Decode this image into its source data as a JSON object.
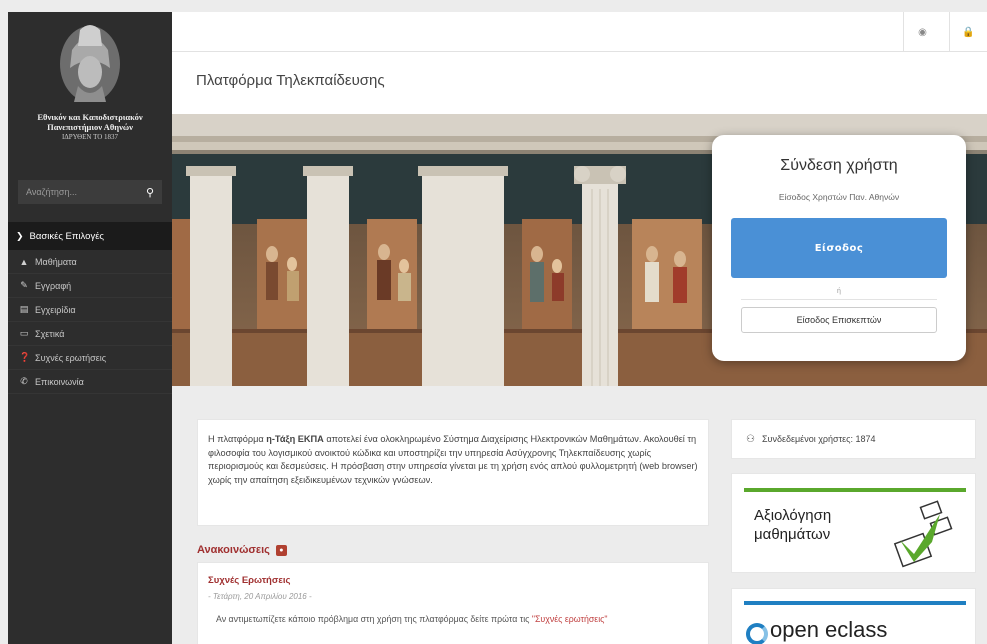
{
  "sidebar": {
    "university_name_line1": "Εθνικόν και Καποδιστριακόν",
    "university_name_line2": "Πανεπιστήμιον Αθηνών",
    "founded": "ΙΔΡΥΘΕΝ ΤΟ 1837",
    "search_placeholder": "Αναζήτηση...",
    "menu_header": "Βασικές Επιλογές",
    "items": [
      {
        "label": "Μαθήματα",
        "icon": "graduation-cap-icon"
      },
      {
        "label": "Εγγραφή",
        "icon": "edit-icon"
      },
      {
        "label": "Εγχειρίδια",
        "icon": "file-icon"
      },
      {
        "label": "Σχετικά",
        "icon": "credit-card-icon"
      },
      {
        "label": "Συχνές ερωτήσεις",
        "icon": "question-circle-icon"
      },
      {
        "label": "Επικοινωνία",
        "icon": "phone-icon"
      }
    ]
  },
  "topbar": {
    "icons": [
      "globe-icon",
      "lock-icon"
    ]
  },
  "page": {
    "title": "Πλατφόρμα Τηλεκπαίδευσης"
  },
  "login": {
    "title": "Σύνδεση χρήστη",
    "subtitle": "Είσοδος Χρηστών Παν. Αθηνών",
    "login_button": "Είσοδος",
    "or": "ή",
    "guest_button": "Είσοδος Επισκεπτών",
    "button_color": "#4a90d6"
  },
  "intro": {
    "prefix": "Η πλατφόρμα ",
    "brand": "η-Τάξη ΕΚΠΑ",
    "text": " αποτελεί ένα ολοκληρωμένο Σύστημα Διαχείρισης Ηλεκτρονικών Μαθημάτων. Ακολουθεί τη φιλοσοφία του λογισμικού ανοικτού κώδικα και υποστηρίζει την υπηρεσία Ασύγχρονης Τηλεκπαίδευσης χωρίς περιορισμούς και δεσμεύσεις. Η πρόσβαση στην υπηρεσία γίνεται με τη χρήση ενός απλού φυλλομετρητή (web browser) χωρίς την απαίτηση εξειδικευμένων τεχνικών γνώσεων."
  },
  "announcements": {
    "title": "Ανακοινώσεις",
    "item_title": "Συχνές Ερωτήσεις",
    "item_date": "- Τετάρτη, 20 Απριλίου 2016 -",
    "item_text": "Αν αντιμετωπίζετε κάποιο πρόβλημα στη χρήση της πλατφόρμας δείτε πρώτα τις ",
    "item_link": "\"Συχνές ερωτήσεις\""
  },
  "widgets": {
    "online_users": "Συνδεδεμένοι χρήστες: 1874",
    "eval_line1": "Αξιολόγηση",
    "eval_line2": "μαθημάτων",
    "eclass_logo": "open eclass"
  },
  "colors": {
    "sidebar_bg": "#2d2d2d",
    "accent_red": "#a03030",
    "eval_green": "#5aa82c",
    "eclass_blue": "#1f7fc2"
  }
}
